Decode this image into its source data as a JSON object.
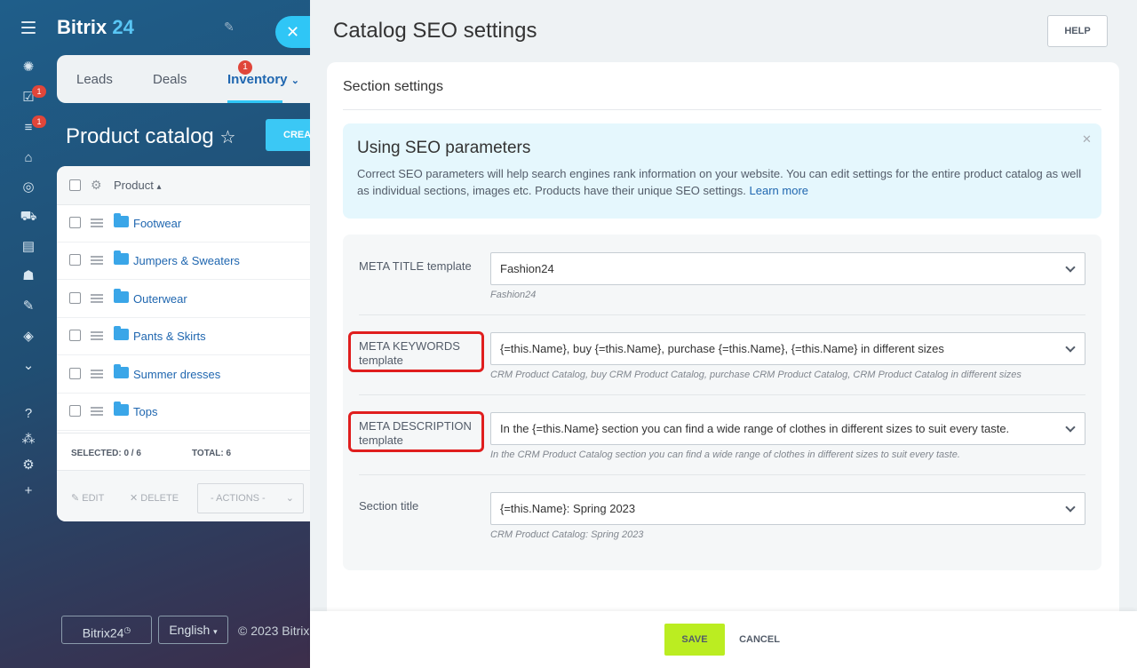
{
  "app": {
    "brand_main": "Bitrix",
    "brand_num": "24",
    "rail_badges": [
      "1",
      "1"
    ]
  },
  "nav": {
    "tabs": [
      {
        "label": "Leads"
      },
      {
        "label": "Deals",
        "badge": "1"
      },
      {
        "label": "Inventory"
      }
    ]
  },
  "catalog": {
    "title": "Product catalog",
    "create_label": "CREA",
    "column_product": "Product",
    "rows": [
      "Footwear",
      "Jumpers & Sweaters",
      "Outerwear",
      "Pants & Skirts",
      "Summer dresses",
      "Tops"
    ],
    "selected_label": "SELECTED: 0 / 6",
    "total_label": "TOTAL: 6",
    "edit_label": "EDIT",
    "delete_label": "DELETE",
    "actions_label": "- ACTIONS -"
  },
  "bottom": {
    "bitrix_btn": "Bitrix24",
    "lang_btn": "English",
    "copyright": "© 2023 Bitrix"
  },
  "slider": {
    "title": "Catalog SEO settings",
    "help": "HELP",
    "section_header": "Section settings",
    "info": {
      "title": "Using SEO parameters",
      "text": "Correct SEO parameters will help search engines rank information on your website. You can edit settings for the entire product catalog as well as individual sections, images etc. Products have their unique SEO settings.",
      "link": "Learn more"
    },
    "fields": [
      {
        "label": "META TITLE template",
        "value": "Fashion24",
        "hint": "Fashion24"
      },
      {
        "label": "META KEYWORDS template",
        "value": "{=this.Name}, buy {=this.Name}, purchase {=this.Name}, {=this.Name} in different sizes",
        "hint": "CRM Product Catalog, buy CRM Product Catalog, purchase CRM Product Catalog, CRM Product Catalog in different sizes"
      },
      {
        "label": "META DESCRIPTION template",
        "value": "In the {=this.Name} section you can find a wide range of clothes in different sizes to suit every taste.",
        "hint": "In the CRM Product Catalog section you can find a wide range of clothes in different sizes to suit every taste."
      },
      {
        "label": "Section title",
        "value": "{=this.Name}: Spring 2023",
        "hint": "CRM Product Catalog: Spring 2023"
      }
    ],
    "save": "SAVE",
    "cancel": "CANCEL"
  },
  "colors": {
    "accent": "#2fc6f6",
    "save_green": "#bbed21",
    "highlight_red": "#e01e1e"
  }
}
